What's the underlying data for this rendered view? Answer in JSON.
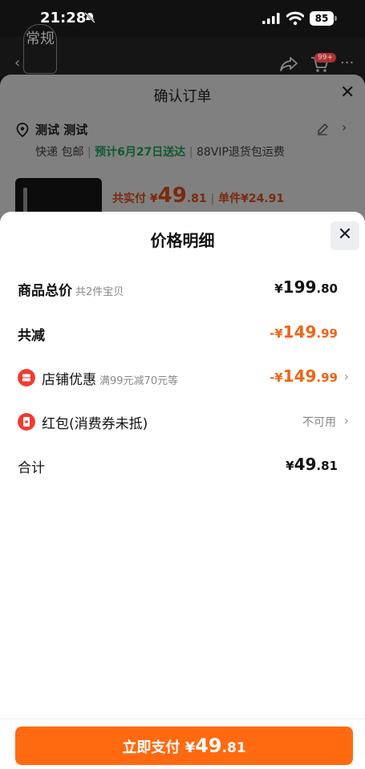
{
  "status_bar": {
    "time": "21:28",
    "battery": "85"
  },
  "background_page": {
    "category_tag": "常规",
    "cart_badge": "99+",
    "back_glyph": "‹",
    "more_glyph": "···"
  },
  "confirm_order": {
    "title": "确认订单",
    "recipient": "测试 测试",
    "shipping": "快递 包邮",
    "delivery": "预计6月27日送达",
    "separator": "|",
    "perk": "88VIP退货包运费",
    "pay_label": "共实付 ¥",
    "pay_int": "49",
    "pay_cents": ".81",
    "unit_label": "单件",
    "unit_price": "¥24.91"
  },
  "price_detail": {
    "title": "价格明细",
    "close_glyph": "✕",
    "rows": {
      "total": {
        "label": "商品总价",
        "sub": "共2件宝贝",
        "yen": "¥",
        "int": "199",
        "cents": ".80"
      },
      "reduction": {
        "label": "共减",
        "prefix": "-¥",
        "int": "149",
        "cents": ".99"
      },
      "shop_discount": {
        "label": "店铺优惠",
        "sub": "满99元减70元等",
        "prefix": "-¥",
        "int": "149",
        "cents": ".99"
      },
      "red_packet": {
        "label": "红包(消费券未抵)",
        "status": "不可用"
      },
      "sum": {
        "label": "合计",
        "yen": "¥",
        "int": "49",
        "cents": ".81"
      }
    }
  },
  "pay_button": {
    "label": "立即支付",
    "yen": "¥",
    "int": "49",
    "cents": ".81"
  },
  "colors": {
    "accent": "#ff6a10",
    "discount": "#f06415",
    "delivery_green": "#0d5a33"
  }
}
